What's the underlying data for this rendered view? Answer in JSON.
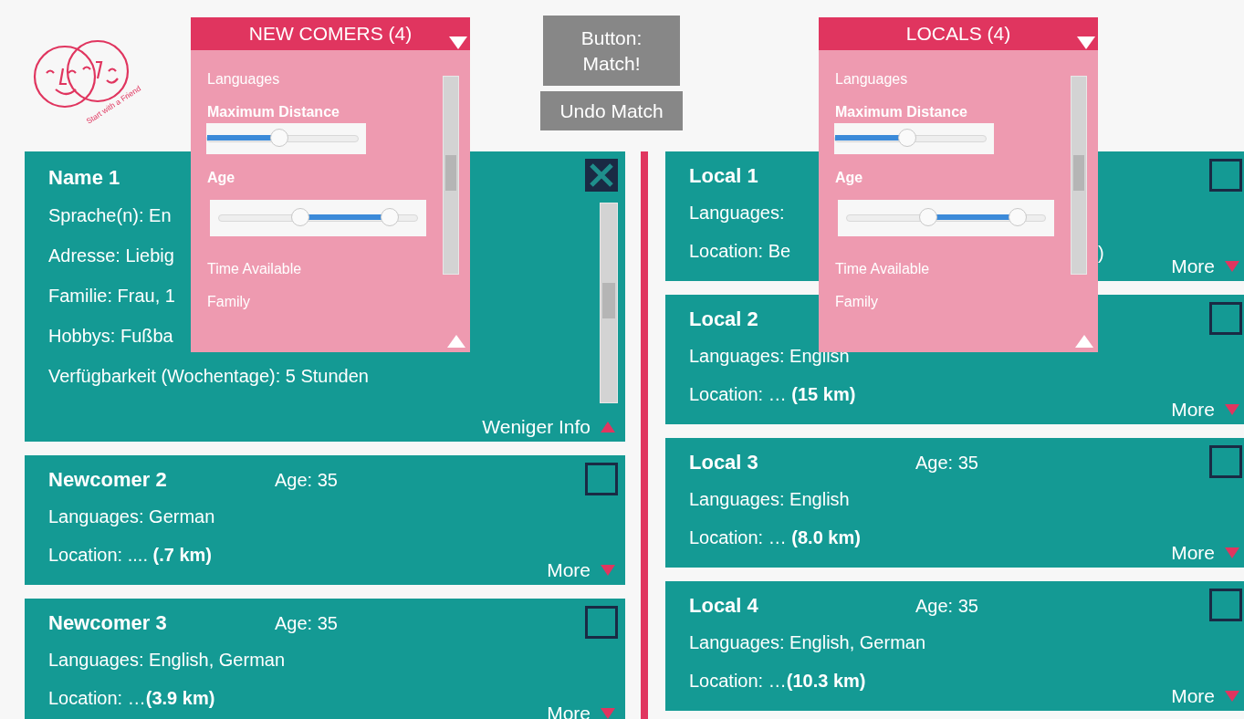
{
  "logo": {
    "tagline": "Start with a Friend"
  },
  "actions": [
    {
      "label": "Button: Match!"
    },
    {
      "label": "Undo Match"
    }
  ],
  "newcomers": {
    "cards": [
      {
        "kind": "expanded",
        "title": "Name 1",
        "checked": true,
        "lines": [
          "Sprache(n): En",
          "Adresse: Liebig",
          "Familie: Frau, 1",
          "Hobbys: Fußba",
          "Verfügbarkeit (Wochentage): 5 Stunden"
        ],
        "toggle": "Weniger Info"
      },
      {
        "kind": "collapsed",
        "title": "Newcomer 2",
        "age": "Age: 35",
        "checked": false,
        "lines": [
          "Languages: German",
          "Location: .... **(.7 km)**"
        ],
        "toggle": "More"
      },
      {
        "kind": "collapsed",
        "title": "Newcomer 3",
        "age": "Age: 35",
        "checked": false,
        "lines": [
          "Languages: English, German",
          "Location: …**(3.9 km)**"
        ],
        "toggle": "More"
      }
    ]
  },
  "locals": {
    "cards": [
      {
        "kind": "collapsed",
        "title": "Local 1",
        "checked": false,
        "lines": [
          "Languages:",
          "Location: Be"
        ],
        "tail": ")",
        "toggle": "More"
      },
      {
        "kind": "collapsed",
        "title": "Local 2",
        "checked": false,
        "lines": [
          "Languages: English",
          "Location: … **(15 km)**"
        ],
        "toggle": "More"
      },
      {
        "kind": "collapsed",
        "title": "Local 3",
        "age": "Age: 35",
        "checked": false,
        "lines": [
          "Languages: English",
          "Location: … **(8.0 km)**"
        ],
        "toggle": "More"
      },
      {
        "kind": "collapsed",
        "title": "Local 4",
        "age": "Age: 35",
        "checked": false,
        "lines": [
          "Languages: English, German",
          "Location: …**(10.3 km)**"
        ],
        "toggle": "More"
      }
    ]
  },
  "panels": [
    {
      "title": "NEW COMERS (4)",
      "filters": [
        {
          "kind": "text",
          "label": "Languages"
        },
        {
          "kind": "slider",
          "label": "Maximum Distance",
          "level": 0.48
        },
        {
          "kind": "range",
          "label": "Age",
          "thumbs": [
            {
              "level": 0.41
            },
            {
              "level": 0.86
            }
          ]
        },
        {
          "kind": "text",
          "label": "Time Available"
        },
        {
          "kind": "text",
          "label": "Family"
        }
      ]
    },
    {
      "title": "LOCALS (4)",
      "filters": [
        {
          "kind": "text",
          "label": "Languages"
        },
        {
          "kind": "slider",
          "label": "Maximum Distance",
          "level": 0.48
        },
        {
          "kind": "range",
          "label": "Age",
          "thumbs": [
            {
              "level": 0.41
            },
            {
              "level": 0.86
            }
          ]
        },
        {
          "kind": "text",
          "label": "Time Available"
        },
        {
          "kind": "text",
          "label": "Family"
        }
      ]
    }
  ]
}
